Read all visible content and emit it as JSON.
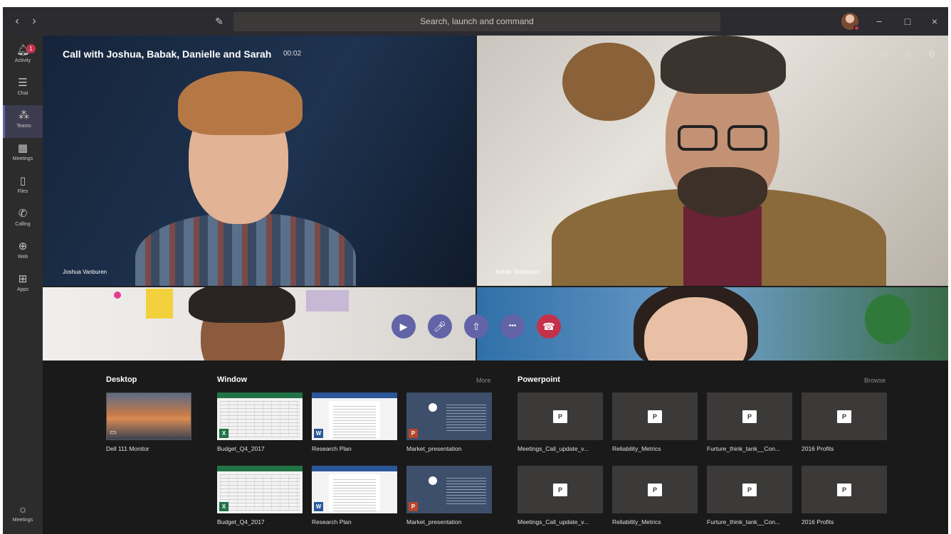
{
  "titlebar": {
    "back": "‹",
    "forward": "›",
    "compose_icon": "✎",
    "search_placeholder": "Search, launch and command",
    "minimize": "−",
    "maximize": "□",
    "close": "×"
  },
  "rail": {
    "items": [
      {
        "label": "Activity",
        "icon": "bell-icon",
        "glyph": "🔔︎",
        "badge": "1"
      },
      {
        "label": "Chat",
        "icon": "chat-icon",
        "glyph": "☰"
      },
      {
        "label": "Teams",
        "icon": "teams-icon",
        "glyph": "⁂"
      },
      {
        "label": "Meetings",
        "icon": "calendar-icon",
        "glyph": "▦"
      },
      {
        "label": "Files",
        "icon": "file-icon",
        "glyph": "▯"
      },
      {
        "label": "Calling",
        "icon": "phone-icon",
        "glyph": "✆"
      },
      {
        "label": "Web",
        "icon": "globe-icon",
        "glyph": "⊕"
      },
      {
        "label": "Apps",
        "icon": "apps-icon",
        "glyph": "⊞"
      }
    ],
    "bottom": {
      "label": "Meetings",
      "icon": "lightbulb-icon",
      "glyph": "☼"
    }
  },
  "call": {
    "title": "Call with Joshua, Babak, Danielle and Sarah",
    "timer": "00:02",
    "participants": [
      {
        "name": "Joshua Vanburen"
      },
      {
        "name": "Babak Shammas"
      },
      {
        "name": ""
      },
      {
        "name": ""
      }
    ],
    "top_icons": [
      {
        "name": "expand-icon",
        "glyph": "⛶"
      },
      {
        "name": "chat-icon",
        "glyph": "▭"
      },
      {
        "name": "participants-icon",
        "glyph": "☺"
      },
      {
        "name": "settings-icon",
        "glyph": "⚙"
      }
    ],
    "controls": [
      {
        "name": "video-button",
        "glyph": "▶"
      },
      {
        "name": "mute-button",
        "glyph": "🎤︎"
      },
      {
        "name": "share-screen-button",
        "glyph": "⇧"
      },
      {
        "name": "more-options-button",
        "glyph": "•••"
      },
      {
        "name": "hang-up-button",
        "glyph": "☎"
      }
    ]
  },
  "tray": {
    "desktop": {
      "title": "Desktop",
      "items": [
        {
          "label": "Dell 111 Monitor"
        }
      ]
    },
    "window": {
      "title": "Window",
      "more": "More",
      "row1": [
        {
          "label": "Budget_Q4_2017",
          "app": "X"
        },
        {
          "label": "Research Plan",
          "app": "W"
        },
        {
          "label": "Market_presentation",
          "app": "P"
        }
      ],
      "row2": [
        {
          "label": "Budget_Q4_2017",
          "app": "X"
        },
        {
          "label": "Research Plan",
          "app": "W"
        },
        {
          "label": "Market_presentation",
          "app": "P"
        }
      ]
    },
    "powerpoint": {
      "title": "Powerpoint",
      "browse": "Browse",
      "logo": "P",
      "row1": [
        {
          "label": "Meetings_Call_update_v..."
        },
        {
          "label": "Reliability_Metrics"
        },
        {
          "label": "Furture_think_tank__Con..."
        },
        {
          "label": "2016 Profits"
        }
      ],
      "row2": [
        {
          "label": "Meetings_Call_update_v..."
        },
        {
          "label": "Reliability_Metrics"
        },
        {
          "label": "Furture_think_tank__Con..."
        },
        {
          "label": "2016 Profits"
        }
      ]
    }
  }
}
